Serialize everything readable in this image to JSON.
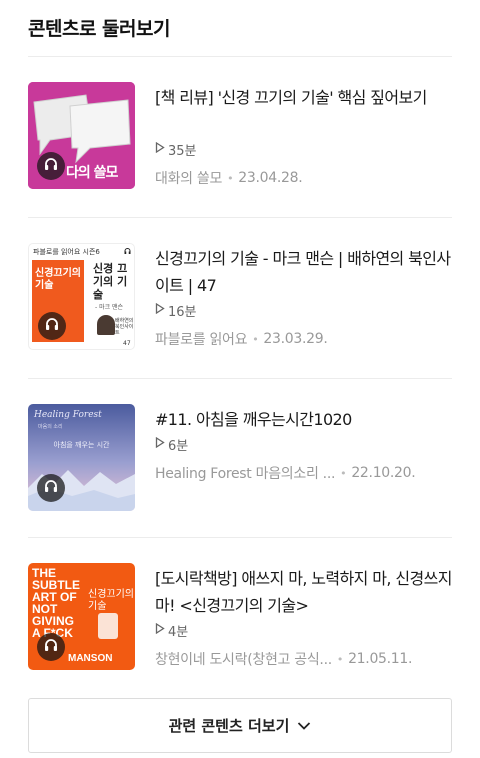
{
  "section": {
    "title": "콘텐츠로 둘러보기"
  },
  "items": [
    {
      "title": "[책 리뷰] '신경 끄기의 기술' 핵심 짚어보기",
      "duration": "35분",
      "source": "대화의 쓸모",
      "date": "23.04.28.",
      "thumb_text": "다의 쓸모",
      "thumb_color": "#c8399a"
    },
    {
      "title": "신경끄기의 기술 - 마크 맨슨 | 배하연의 북인사이트 | 47",
      "duration": "16분",
      "source": "파블로를 읽어요",
      "date": "23.03.29.",
      "thumb_header": "파블로를 읽어요 시즌6",
      "thumb_book": "신경끄기의 기술",
      "thumb_title": "신경 끄기의 기술",
      "thumb_author": "- 마크 맨슨",
      "thumb_caption": "배하연의 북인사이트",
      "thumb_no": "47",
      "thumb_color": "#ffffff"
    },
    {
      "title": "#11. 아침을 깨우는시간1020",
      "duration": "6분",
      "source": "Healing Forest 마음의소리 ...",
      "date": "22.10.20.",
      "thumb_brand": "Healing Forest",
      "thumb_small": "마음의 소리",
      "thumb_caption": "아침을 깨우는 시간",
      "thumb_color": "#5e6aa8"
    },
    {
      "title": "[도시락책방] 애쓰지 마, 노력하지 마, 신경쓰지 마! <신경끄기의 기술>",
      "duration": "4분",
      "source": "창현이네 도시락(창현고 공식...",
      "date": "21.05.11.",
      "thumb_lines": [
        "THE",
        "SUBTLE",
        "ART OF",
        "NOT",
        "GIVING",
        "A F*CK"
      ],
      "thumb_korean": "신경끄기의 기술",
      "thumb_author": "MANSON",
      "thumb_color": "#f25a12"
    }
  ],
  "more_button": {
    "label": "관련 콘텐츠 더보기"
  }
}
